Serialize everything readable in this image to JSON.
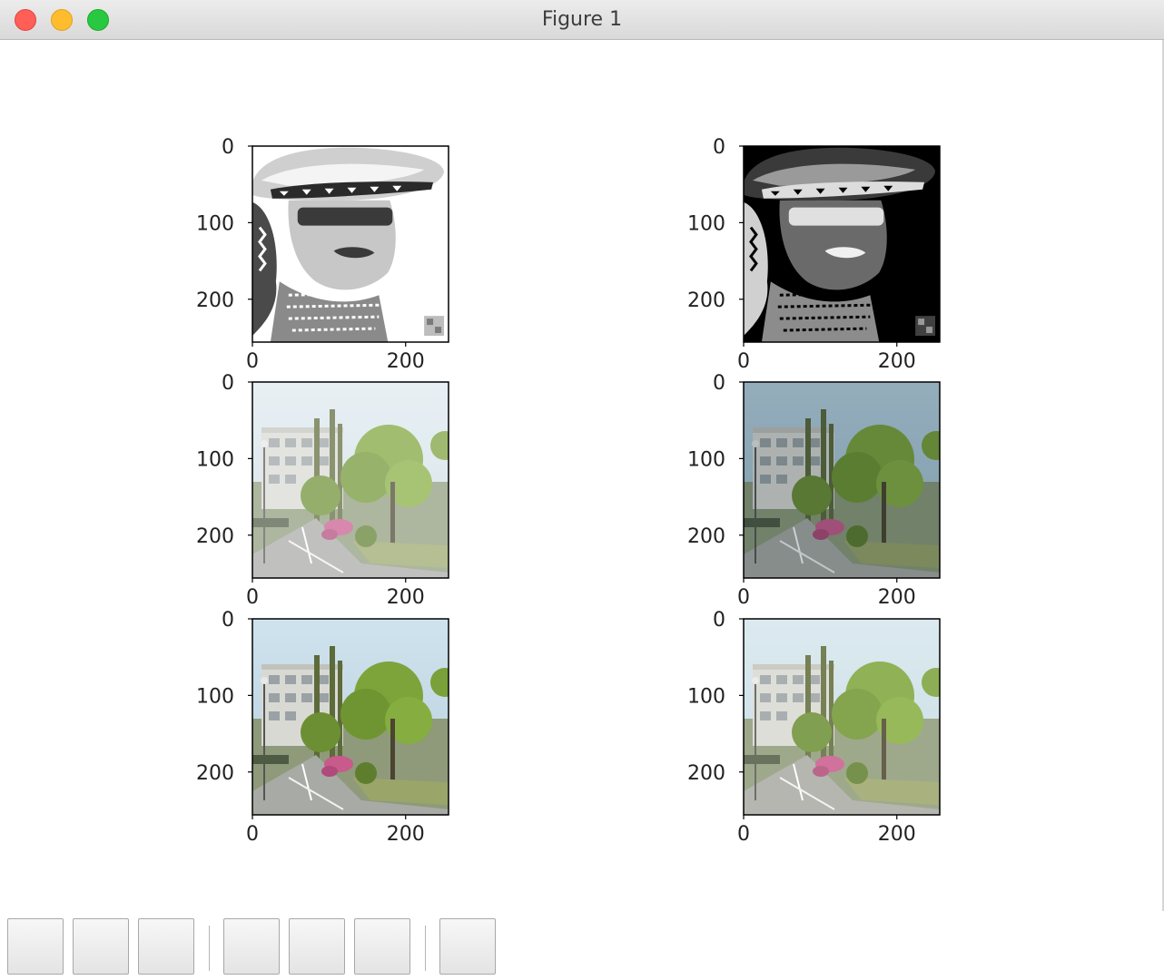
{
  "window": {
    "title": "Figure 1"
  },
  "subplots": [
    {
      "row": 0,
      "col": 0,
      "image": "grayscale-woman-with-hat",
      "xticks": [
        "0",
        "200"
      ],
      "yticks": [
        "0",
        "100",
        "200"
      ]
    },
    {
      "row": 0,
      "col": 1,
      "image": "inverted-grayscale-woman-with-hat",
      "xticks": [
        "0",
        "200"
      ],
      "yticks": [
        "0",
        "100",
        "200"
      ]
    },
    {
      "row": 1,
      "col": 0,
      "image": "street-scene-faded",
      "xticks": [
        "0",
        "200"
      ],
      "yticks": [
        "0",
        "100",
        "200"
      ]
    },
    {
      "row": 1,
      "col": 1,
      "image": "street-scene-darker",
      "xticks": [
        "0",
        "200"
      ],
      "yticks": [
        "0",
        "100",
        "200"
      ]
    },
    {
      "row": 2,
      "col": 0,
      "image": "street-scene-original",
      "xticks": [
        "0",
        "200"
      ],
      "yticks": [
        "0",
        "100",
        "200"
      ]
    },
    {
      "row": 2,
      "col": 1,
      "image": "street-scene-brighter",
      "xticks": [
        "0",
        "200"
      ],
      "yticks": [
        "0",
        "100",
        "200"
      ]
    }
  ],
  "toolbar": {
    "buttons": [
      "home-button",
      "back-button",
      "forward-button",
      "pan-button",
      "zoom-button",
      "configure-subplots-button",
      "save-button"
    ]
  }
}
